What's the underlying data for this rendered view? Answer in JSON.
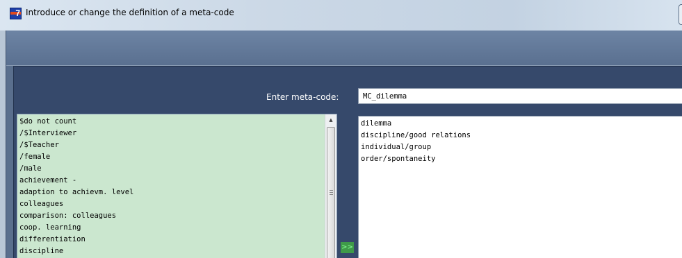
{
  "window": {
    "title": "Introduce or change the definition of a meta-code",
    "icon": "app-icon"
  },
  "meta_code": {
    "label": "Enter meta-code:",
    "value": "MC_dilemma"
  },
  "available_codes": [
    "$do not count",
    "/$Interviewer",
    "/$Teacher",
    "/female",
    "/male",
    "achievement -",
    "adaption to achievm. level",
    "colleagues",
    "comparison: colleagues",
    "coop. learning",
    "differentiation",
    "discipline"
  ],
  "selected_codes": [
    "dilemma",
    "discipline/good relations",
    "individual/group",
    "order/spontaneity"
  ],
  "buttons": {
    "add": ">>",
    "remove": "<<"
  },
  "colors": {
    "panel": "#36496b",
    "list_background": "#cbe7cf",
    "add_button": "#3f9a49",
    "remove_button": "#a04245"
  }
}
